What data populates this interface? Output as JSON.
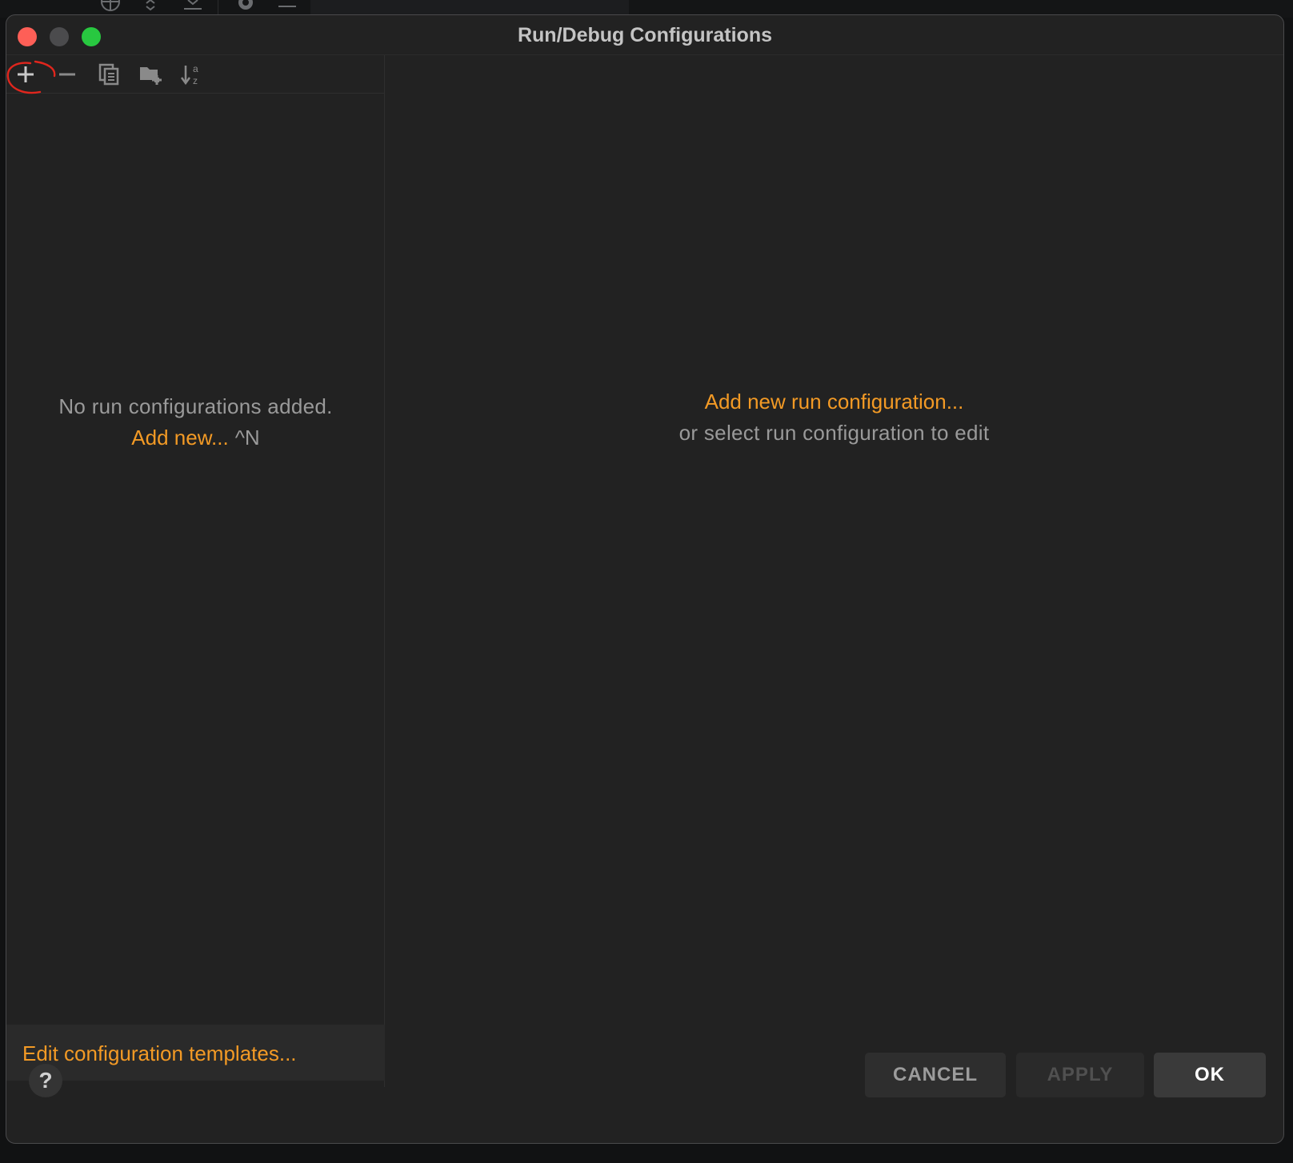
{
  "window": {
    "title": "Run/Debug Configurations"
  },
  "toolbar": {
    "icons": [
      "plus-icon",
      "minus-icon",
      "copy-icon",
      "new-folder-icon",
      "sort-alpha-icon"
    ]
  },
  "left_panel": {
    "empty_message": "No run configurations added.",
    "add_new_label": "Add new...",
    "add_new_shortcut": "^N",
    "templates_link": "Edit configuration templates..."
  },
  "right_panel": {
    "add_link": "Add new run configuration...",
    "hint": "or select run configuration to edit"
  },
  "footer": {
    "help_label": "?",
    "cancel_label": "CANCEL",
    "apply_label": "APPLY",
    "ok_label": "OK"
  },
  "colors": {
    "accent": "#f39a25",
    "background": "#222222",
    "annotation": "#e0261d"
  }
}
